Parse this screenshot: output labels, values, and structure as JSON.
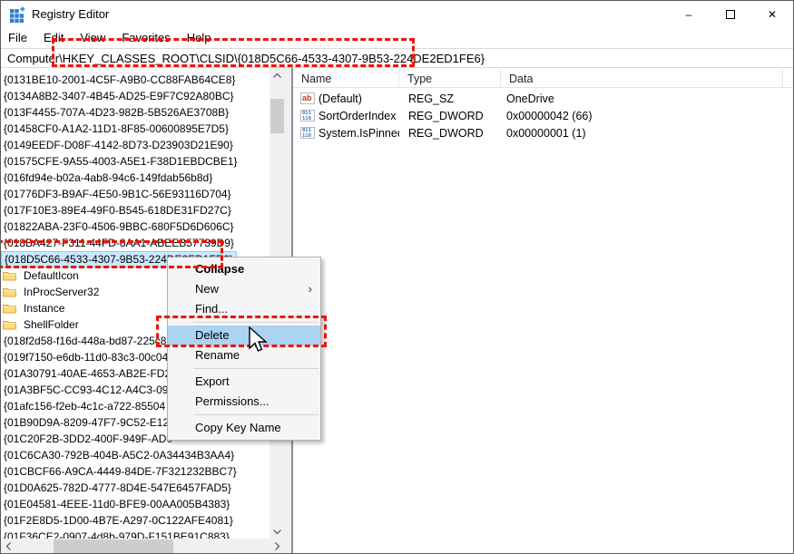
{
  "window": {
    "title": "Registry Editor"
  },
  "titlebar": {
    "minimize_icon": "–",
    "maximize_icon": "▢",
    "close_icon": "✕"
  },
  "menubar": {
    "items": [
      "File",
      "Edit",
      "View",
      "Favorites",
      "Help"
    ]
  },
  "addressbar": {
    "value": "Computer\\HKEY_CLASSES_ROOT\\CLSID\\{018D5C66-4533-4307-9B53-224DE2ED1FE6}"
  },
  "tree": {
    "items": [
      {
        "label": "{0131BE10-2001-4C5F-A9B0-CC88FAB64CE8}",
        "type": "key"
      },
      {
        "label": "{0134A8B2-3407-4B45-AD25-E9F7C92A80BC}",
        "type": "key"
      },
      {
        "label": "{013F4455-707A-4D23-982B-5B526AE3708B}",
        "type": "key"
      },
      {
        "label": "{01458CF0-A1A2-11D1-8F85-00600895E7D5}",
        "type": "key"
      },
      {
        "label": "{0149EEDF-D08F-4142-8D73-D23903D21E90}",
        "type": "key"
      },
      {
        "label": "{01575CFE-9A55-4003-A5E1-F38D1EBDCBE1}",
        "type": "key"
      },
      {
        "label": "{016fd94e-b02a-4ab8-94c6-149fdab56b8d}",
        "type": "key"
      },
      {
        "label": "{01776DF3-B9AF-4E50-9B1C-56E93116D704}",
        "type": "key"
      },
      {
        "label": "{017F10E3-89E4-49F0-B545-618DE31FD27C}",
        "type": "key"
      },
      {
        "label": "{01822ABA-23F0-4506-9BBC-680F5D6D606C}",
        "type": "key"
      },
      {
        "label": "{018BA427-F311-44FD-8AA1-ABEEB57739D9}",
        "type": "key"
      },
      {
        "label": "{018D5C66-4533-4307-9B53-224DE2ED1FE6}",
        "type": "key",
        "selected": true
      },
      {
        "label": "DefaultIcon",
        "type": "subfolder"
      },
      {
        "label": "InProcServer32",
        "type": "subfolder"
      },
      {
        "label": "Instance",
        "type": "subfolder"
      },
      {
        "label": "ShellFolder",
        "type": "subfolder"
      },
      {
        "label": "{018f2d58-f16d-448a-bd87-225c8",
        "type": "key"
      },
      {
        "label": "{019f7150-e6db-11d0-83c3-00c04",
        "type": "key"
      },
      {
        "label": "{01A30791-40AE-4653-AB2E-FD2",
        "type": "key"
      },
      {
        "label": "{01A3BF5C-CC93-4C12-A4C3-09",
        "type": "key"
      },
      {
        "label": "{01afc156-f2eb-4c1c-a722-85504",
        "type": "key"
      },
      {
        "label": "{01B90D9A-8209-47F7-9C52-E124",
        "type": "key"
      },
      {
        "label": "{01C20F2B-3DD2-400F-949F-AD0",
        "type": "key"
      },
      {
        "label": "{01C6CA30-792B-404B-A5C2-0A34434B3AA4}",
        "type": "key"
      },
      {
        "label": "{01CBCF66-A9CA-4449-84DE-7F321232BBC7}",
        "type": "key"
      },
      {
        "label": "{01D0A625-782D-4777-8D4E-547E6457FAD5}",
        "type": "key"
      },
      {
        "label": "{01E04581-4EEE-11d0-BFE9-00AA005B4383}",
        "type": "key"
      },
      {
        "label": "{01F2E8D5-1D00-4B7E-A297-0C122AFE4081}",
        "type": "key"
      },
      {
        "label": "{01F36CE2-0907-4d8b-979D-F151BE91C883}",
        "type": "key"
      }
    ]
  },
  "list": {
    "columns": [
      "Name",
      "Type",
      "Data"
    ],
    "rows": [
      {
        "icon": "string-value-icon",
        "name": "(Default)",
        "type": "REG_SZ",
        "data": "OneDrive"
      },
      {
        "icon": "dword-value-icon",
        "name": "SortOrderIndex",
        "type": "REG_DWORD",
        "data": "0x00000042 (66)"
      },
      {
        "icon": "dword-value-icon",
        "name": "System.IsPinned...",
        "type": "REG_DWORD",
        "data": "0x00000001 (1)"
      }
    ],
    "icon_glyphs": {
      "string": "ab",
      "dword_top": "011",
      "dword_bottom": "110"
    }
  },
  "context_menu": {
    "items": [
      {
        "label": "Collapse",
        "bold": true
      },
      {
        "label": "New",
        "submenu": true
      },
      {
        "label": "Find..."
      },
      {
        "separator": true
      },
      {
        "label": "Delete",
        "hover": true
      },
      {
        "label": "Rename"
      },
      {
        "separator": true
      },
      {
        "label": "Export"
      },
      {
        "label": "Permissions..."
      },
      {
        "separator": true
      },
      {
        "label": "Copy Key Name"
      }
    ],
    "submenu_arrow": "›"
  },
  "colors": {
    "annotation_red": "#ee1409",
    "selection_blue": "#cce8ff",
    "menu_hover_blue": "#aad4f2",
    "folder_yellow": "#ffd977",
    "app_icon_blue": "#2d7dd2"
  }
}
